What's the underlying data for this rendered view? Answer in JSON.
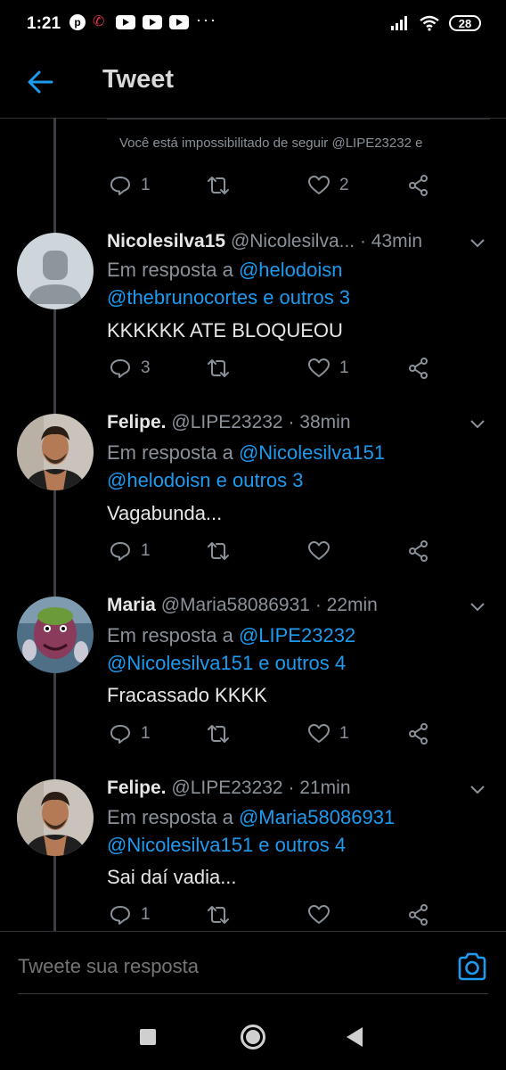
{
  "status_bar": {
    "time": "1:21",
    "battery": "28",
    "icons": [
      "pinterest-icon",
      "missed-call-icon",
      "youtube-icon",
      "youtube-icon",
      "youtube-icon",
      "more-dots-icon",
      "signal-icon",
      "wifi-icon",
      "battery-icon"
    ]
  },
  "header": {
    "title": "Tweet",
    "back_icon": "back-arrow-icon"
  },
  "top_tweet": {
    "notice": "Você está impossibilitado de seguir @LIPE23232 e",
    "replies": "1",
    "retweets": "",
    "likes": "2"
  },
  "tweets": [
    {
      "name": "Nicolesilva15",
      "handle": "@Nicolesilva...",
      "time": "· 43min",
      "reply_prefix": "Em resposta a ",
      "reply_mention_1": "@helodoisn",
      "reply_line_2": "@thebrunocortes e outros 3",
      "text": "KKKKKK ATE BLOQUEOU",
      "replies": "3",
      "likes": "1"
    },
    {
      "name": "Felipe.",
      "handle": "@LIPE23232",
      "time": "· 38min",
      "reply_prefix": "Em resposta a ",
      "reply_mention_1": "@Nicolesilva151",
      "reply_line_2": "@helodoisn e outros 3",
      "text": "Vagabunda...",
      "replies": "1",
      "likes": ""
    },
    {
      "name": "Maria",
      "handle": "@Maria58086931",
      "time": "· 22min",
      "reply_prefix": "Em resposta a ",
      "reply_mention_1": "@LIPE23232",
      "reply_line_2": "@Nicolesilva151 e outros 4",
      "text": "Fracassado KKKK",
      "replies": "1",
      "likes": "1"
    },
    {
      "name": "Felipe.",
      "handle": "@LIPE23232",
      "time": "· 21min",
      "reply_prefix": "Em resposta a ",
      "reply_mention_1": "@Maria58086931",
      "reply_line_2": "@Nicolesilva151 e outros 4",
      "text": "Sai daí vadia...",
      "replies": "1",
      "likes": ""
    }
  ],
  "compose": {
    "placeholder": "Tweete sua resposta",
    "camera_icon": "camera-icon"
  },
  "colors": {
    "background": "#000000",
    "accent": "#1d9bf0",
    "muted": "#8a9198",
    "text": "#e6e6e6"
  }
}
